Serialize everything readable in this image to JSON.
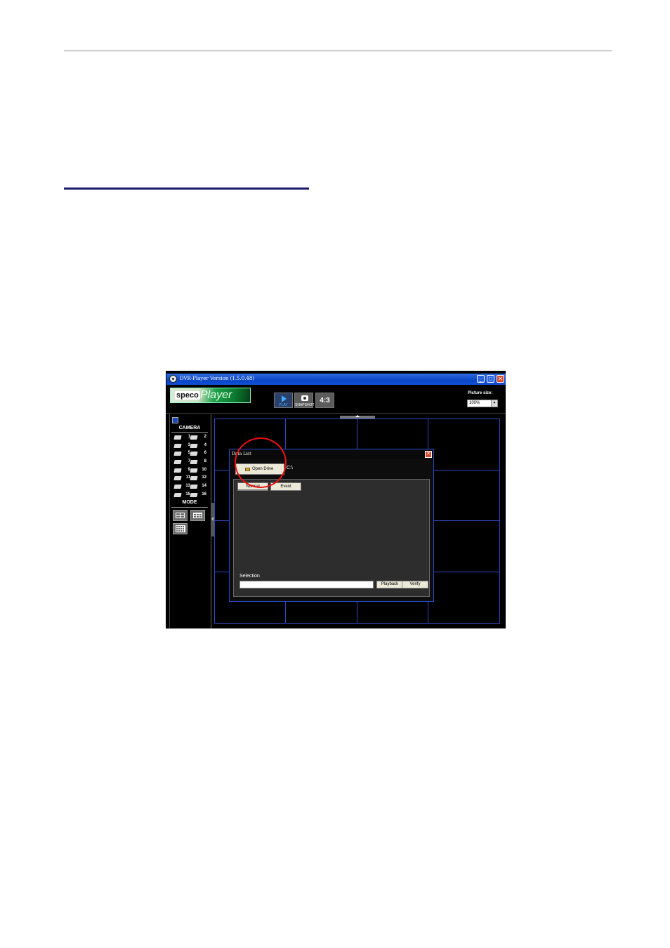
{
  "document": {
    "top_rule_color": "#8a8a8a",
    "section_rule_color": "#1c1c6e"
  },
  "app": {
    "window_title": "DVR-Player Version (1.5.0.48)",
    "logo": {
      "brand": "speco",
      "product": "Player"
    },
    "toolbar": {
      "play_label": "PLAY",
      "snapshot_label": "SNAPSHOT",
      "aspect_label": "4:3"
    },
    "picture_size": {
      "label": "Picture size:",
      "value": "100%"
    },
    "sidebar": {
      "camera_header": "CAMERA",
      "cameras": [
        "1",
        "2",
        "3",
        "4",
        "5",
        "6",
        "7",
        "8",
        "9",
        "10",
        "11",
        "12",
        "13",
        "14",
        "15",
        "16"
      ],
      "mode_header": "MODE"
    },
    "dialog": {
      "title": "Data List",
      "open_drive_label": "Open Drive",
      "path": "C:\\",
      "tabs": [
        "Normal",
        "Event"
      ],
      "selection_label": "Selection",
      "selection_value": "",
      "playback_label": "Playback",
      "verify_label": "Verify"
    },
    "colors": {
      "grid_line": "#2c49c8",
      "highlight_circle": "#e11111",
      "titlebar": "#0a46c6"
    }
  }
}
